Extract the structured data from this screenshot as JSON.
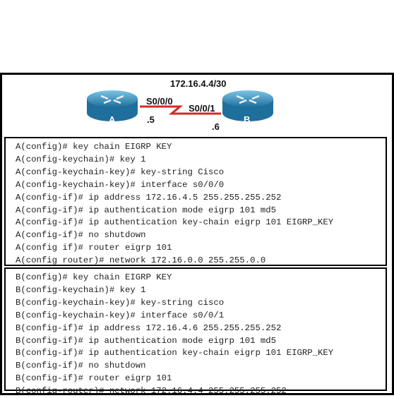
{
  "topology": {
    "subnet": "172.16.4.4/30",
    "link_color": "#d62828",
    "router_color": "#2a8fc0",
    "router_a": {
      "name": "A",
      "interface": "S0/0/0",
      "host": ".5"
    },
    "router_b": {
      "name": "B",
      "interface": "S0/0/1",
      "host": ".6"
    }
  },
  "config_a": [
    "A(config)# key chain EIGRP KEY",
    "A(config-keychain)# key 1",
    "A(config-keychain-key)# key-string Cisco",
    "A(config-keychain-key)# interface s0/0/0",
    "A(config-if)# ip address 172.16.4.5 255.255.255.252",
    "A(config-if)# ip authentication mode eigrp 101 md5",
    "A(config-if)# ip authentication key-chain eigrp 101 EIGRP_KEY",
    "A(config-if)# no shutdown",
    "A(config if)# router eigrp 101",
    "A(config router)# network 172.16.0.0 255.255.0.0"
  ],
  "config_b": [
    "B(config)# key chain EIGRP KEY",
    "B(config-keychain)# key 1",
    "B(config-keychain-key)# key-string cisco",
    "B(config-keychain-key)# interface s0/0/1",
    "B(config-if)# ip address 172.16.4.6 255.255.255.252",
    "B(config-if)# ip authentication mode eigrp 101 md5",
    "B(config-if)# ip authentication key-chain eigrp 101 EIGRP_KEY",
    "B(config-if)# no shutdown",
    "B(config-if)# router eigrp 101",
    "B(config-router)# network 172.16.4.4 255.255.255.252"
  ]
}
